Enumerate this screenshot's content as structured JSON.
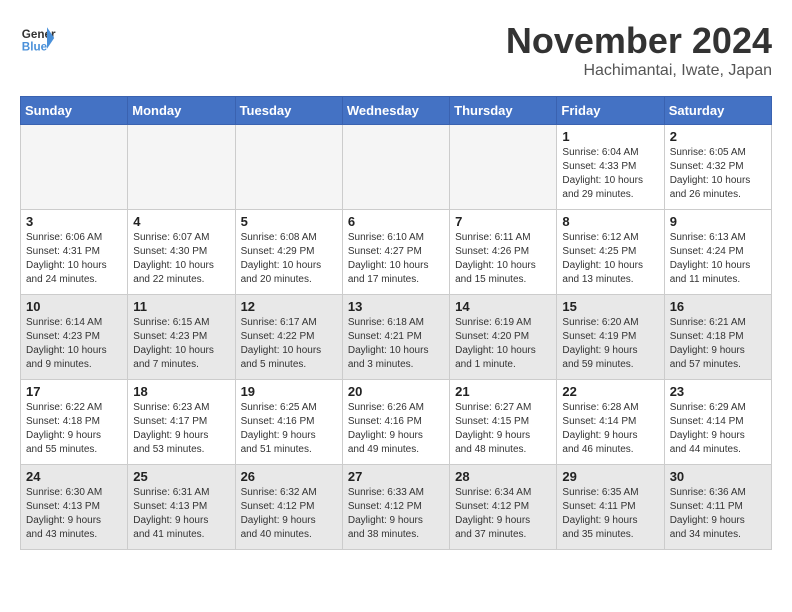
{
  "header": {
    "logo_line1": "General",
    "logo_line2": "Blue",
    "title": "November 2024",
    "subtitle": "Hachimantai, Iwate, Japan"
  },
  "weekdays": [
    "Sunday",
    "Monday",
    "Tuesday",
    "Wednesday",
    "Thursday",
    "Friday",
    "Saturday"
  ],
  "weeks": [
    [
      {
        "num": "",
        "info": "",
        "empty": true
      },
      {
        "num": "",
        "info": "",
        "empty": true
      },
      {
        "num": "",
        "info": "",
        "empty": true
      },
      {
        "num": "",
        "info": "",
        "empty": true
      },
      {
        "num": "",
        "info": "",
        "empty": true
      },
      {
        "num": "1",
        "info": "Sunrise: 6:04 AM\nSunset: 4:33 PM\nDaylight: 10 hours\nand 29 minutes.",
        "empty": false
      },
      {
        "num": "2",
        "info": "Sunrise: 6:05 AM\nSunset: 4:32 PM\nDaylight: 10 hours\nand 26 minutes.",
        "empty": false
      }
    ],
    [
      {
        "num": "3",
        "info": "Sunrise: 6:06 AM\nSunset: 4:31 PM\nDaylight: 10 hours\nand 24 minutes.",
        "empty": false
      },
      {
        "num": "4",
        "info": "Sunrise: 6:07 AM\nSunset: 4:30 PM\nDaylight: 10 hours\nand 22 minutes.",
        "empty": false
      },
      {
        "num": "5",
        "info": "Sunrise: 6:08 AM\nSunset: 4:29 PM\nDaylight: 10 hours\nand 20 minutes.",
        "empty": false
      },
      {
        "num": "6",
        "info": "Sunrise: 6:10 AM\nSunset: 4:27 PM\nDaylight: 10 hours\nand 17 minutes.",
        "empty": false
      },
      {
        "num": "7",
        "info": "Sunrise: 6:11 AM\nSunset: 4:26 PM\nDaylight: 10 hours\nand 15 minutes.",
        "empty": false
      },
      {
        "num": "8",
        "info": "Sunrise: 6:12 AM\nSunset: 4:25 PM\nDaylight: 10 hours\nand 13 minutes.",
        "empty": false
      },
      {
        "num": "9",
        "info": "Sunrise: 6:13 AM\nSunset: 4:24 PM\nDaylight: 10 hours\nand 11 minutes.",
        "empty": false
      }
    ],
    [
      {
        "num": "10",
        "info": "Sunrise: 6:14 AM\nSunset: 4:23 PM\nDaylight: 10 hours\nand 9 minutes.",
        "empty": false
      },
      {
        "num": "11",
        "info": "Sunrise: 6:15 AM\nSunset: 4:23 PM\nDaylight: 10 hours\nand 7 minutes.",
        "empty": false
      },
      {
        "num": "12",
        "info": "Sunrise: 6:17 AM\nSunset: 4:22 PM\nDaylight: 10 hours\nand 5 minutes.",
        "empty": false
      },
      {
        "num": "13",
        "info": "Sunrise: 6:18 AM\nSunset: 4:21 PM\nDaylight: 10 hours\nand 3 minutes.",
        "empty": false
      },
      {
        "num": "14",
        "info": "Sunrise: 6:19 AM\nSunset: 4:20 PM\nDaylight: 10 hours\nand 1 minute.",
        "empty": false
      },
      {
        "num": "15",
        "info": "Sunrise: 6:20 AM\nSunset: 4:19 PM\nDaylight: 9 hours\nand 59 minutes.",
        "empty": false
      },
      {
        "num": "16",
        "info": "Sunrise: 6:21 AM\nSunset: 4:18 PM\nDaylight: 9 hours\nand 57 minutes.",
        "empty": false
      }
    ],
    [
      {
        "num": "17",
        "info": "Sunrise: 6:22 AM\nSunset: 4:18 PM\nDaylight: 9 hours\nand 55 minutes.",
        "empty": false
      },
      {
        "num": "18",
        "info": "Sunrise: 6:23 AM\nSunset: 4:17 PM\nDaylight: 9 hours\nand 53 minutes.",
        "empty": false
      },
      {
        "num": "19",
        "info": "Sunrise: 6:25 AM\nSunset: 4:16 PM\nDaylight: 9 hours\nand 51 minutes.",
        "empty": false
      },
      {
        "num": "20",
        "info": "Sunrise: 6:26 AM\nSunset: 4:16 PM\nDaylight: 9 hours\nand 49 minutes.",
        "empty": false
      },
      {
        "num": "21",
        "info": "Sunrise: 6:27 AM\nSunset: 4:15 PM\nDaylight: 9 hours\nand 48 minutes.",
        "empty": false
      },
      {
        "num": "22",
        "info": "Sunrise: 6:28 AM\nSunset: 4:14 PM\nDaylight: 9 hours\nand 46 minutes.",
        "empty": false
      },
      {
        "num": "23",
        "info": "Sunrise: 6:29 AM\nSunset: 4:14 PM\nDaylight: 9 hours\nand 44 minutes.",
        "empty": false
      }
    ],
    [
      {
        "num": "24",
        "info": "Sunrise: 6:30 AM\nSunset: 4:13 PM\nDaylight: 9 hours\nand 43 minutes.",
        "empty": false
      },
      {
        "num": "25",
        "info": "Sunrise: 6:31 AM\nSunset: 4:13 PM\nDaylight: 9 hours\nand 41 minutes.",
        "empty": false
      },
      {
        "num": "26",
        "info": "Sunrise: 6:32 AM\nSunset: 4:12 PM\nDaylight: 9 hours\nand 40 minutes.",
        "empty": false
      },
      {
        "num": "27",
        "info": "Sunrise: 6:33 AM\nSunset: 4:12 PM\nDaylight: 9 hours\nand 38 minutes.",
        "empty": false
      },
      {
        "num": "28",
        "info": "Sunrise: 6:34 AM\nSunset: 4:12 PM\nDaylight: 9 hours\nand 37 minutes.",
        "empty": false
      },
      {
        "num": "29",
        "info": "Sunrise: 6:35 AM\nSunset: 4:11 PM\nDaylight: 9 hours\nand 35 minutes.",
        "empty": false
      },
      {
        "num": "30",
        "info": "Sunrise: 6:36 AM\nSunset: 4:11 PM\nDaylight: 9 hours\nand 34 minutes.",
        "empty": false
      }
    ]
  ]
}
